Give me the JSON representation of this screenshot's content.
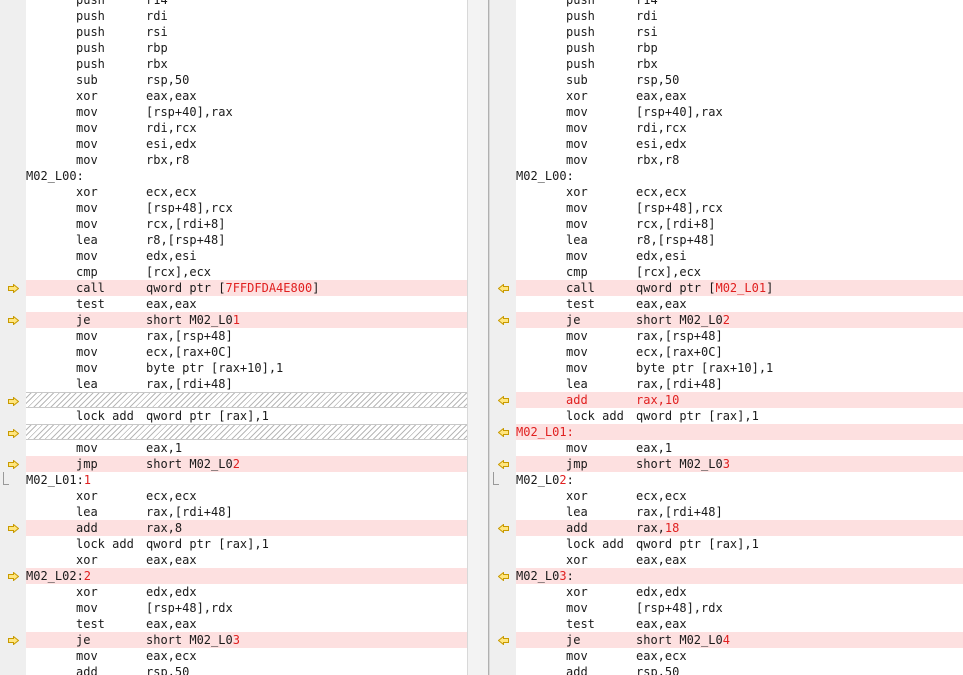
{
  "colors": {
    "changed_bg": "#fde0e0",
    "diff_text": "#e02020",
    "marker": "#e0b000"
  },
  "left_pane": {
    "lines": [
      {
        "op": "push",
        "args": "r14"
      },
      {
        "op": "push",
        "args": "rdi"
      },
      {
        "op": "push",
        "args": "rsi"
      },
      {
        "op": "push",
        "args": "rbp"
      },
      {
        "op": "push",
        "args": "rbx"
      },
      {
        "op": "sub",
        "args": "rsp,50"
      },
      {
        "op": "xor",
        "args": "eax,eax"
      },
      {
        "op": "mov",
        "args": "[rsp+40],rax"
      },
      {
        "op": "mov",
        "args": "rdi,rcx"
      },
      {
        "op": "mov",
        "args": "esi,edx"
      },
      {
        "op": "mov",
        "args": "rbx,r8"
      },
      {
        "label": "M02_L00:"
      },
      {
        "op": "xor",
        "args": "ecx,ecx"
      },
      {
        "op": "mov",
        "args": "[rsp+48],rcx"
      },
      {
        "op": "mov",
        "args": "rcx,[rdi+8]"
      },
      {
        "op": "lea",
        "args": "r8,[rsp+48]"
      },
      {
        "op": "mov",
        "args": "edx,esi"
      },
      {
        "op": "cmp",
        "args": "[rcx],ecx"
      },
      {
        "op": "call",
        "args": "qword ptr [",
        "args_red": "7FFDFDA4E800",
        "args_after": "]",
        "changed": true,
        "marker": "arrow"
      },
      {
        "op": "test",
        "args": "eax,eax"
      },
      {
        "op": "je",
        "args": "short M02_L0",
        "args_red": "1",
        "changed": true,
        "marker": "arrow"
      },
      {
        "op": "mov",
        "args": "rax,[rsp+48]"
      },
      {
        "op": "mov",
        "args": "ecx,[rax+0C]"
      },
      {
        "op": "mov",
        "args": "byte ptr [rax+10],1"
      },
      {
        "op": "lea",
        "args": "rax,[rdi+48]"
      },
      {
        "missing": true,
        "marker": "arrow"
      },
      {
        "op": "lock add",
        "args": "qword ptr [rax],1"
      },
      {
        "missing": true,
        "marker": "arrow"
      },
      {
        "op": "mov",
        "args": "eax,1"
      },
      {
        "op": "jmp",
        "args": "short M02_L0",
        "args_red": "2",
        "changed": true,
        "marker": "arrow"
      },
      {
        "label": "M02_L01:",
        "label_red": "1",
        "changed_label": true,
        "marker": "bracket"
      },
      {
        "op": "xor",
        "args": "ecx,ecx"
      },
      {
        "op": "lea",
        "args": "rax,[rdi+48]"
      },
      {
        "op": "add",
        "args": "rax,8",
        "changed": true,
        "marker": "arrow"
      },
      {
        "op": "lock add",
        "args": "qword ptr [rax],1"
      },
      {
        "op": "xor",
        "args": "eax,eax"
      },
      {
        "label": "M02_L02:",
        "label_red": "2",
        "changed": true,
        "marker": "arrow"
      },
      {
        "op": "xor",
        "args": "edx,edx"
      },
      {
        "op": "mov",
        "args": "[rsp+48],rdx"
      },
      {
        "op": "test",
        "args": "eax,eax"
      },
      {
        "op": "je",
        "args": "short M02_L0",
        "args_red": "3",
        "changed": true,
        "marker": "arrow"
      },
      {
        "op": "mov",
        "args": "eax,ecx"
      },
      {
        "op": "add",
        "args": "rsp,50"
      }
    ]
  },
  "right_pane": {
    "lines": [
      {
        "op": "push",
        "args": "r14"
      },
      {
        "op": "push",
        "args": "rdi"
      },
      {
        "op": "push",
        "args": "rsi"
      },
      {
        "op": "push",
        "args": "rbp"
      },
      {
        "op": "push",
        "args": "rbx"
      },
      {
        "op": "sub",
        "args": "rsp,50"
      },
      {
        "op": "xor",
        "args": "eax,eax"
      },
      {
        "op": "mov",
        "args": "[rsp+40],rax"
      },
      {
        "op": "mov",
        "args": "rdi,rcx"
      },
      {
        "op": "mov",
        "args": "esi,edx"
      },
      {
        "op": "mov",
        "args": "rbx,r8"
      },
      {
        "label": "M02_L00:"
      },
      {
        "op": "xor",
        "args": "ecx,ecx"
      },
      {
        "op": "mov",
        "args": "[rsp+48],rcx"
      },
      {
        "op": "mov",
        "args": "rcx,[rdi+8]"
      },
      {
        "op": "lea",
        "args": "r8,[rsp+48]"
      },
      {
        "op": "mov",
        "args": "edx,esi"
      },
      {
        "op": "cmp",
        "args": "[rcx],ecx"
      },
      {
        "op": "call",
        "args": "qword ptr [",
        "args_red": "M02_L01",
        "args_after": "]",
        "changed": true,
        "marker": "arrow"
      },
      {
        "op": "test",
        "args": "eax,eax"
      },
      {
        "op": "je",
        "args": "short M02_L0",
        "args_red": "2",
        "changed": true,
        "marker": "arrow"
      },
      {
        "op": "mov",
        "args": "rax,[rsp+48]"
      },
      {
        "op": "mov",
        "args": "ecx,[rax+0C]"
      },
      {
        "op": "mov",
        "args": "byte ptr [rax+10],1"
      },
      {
        "op": "lea",
        "args": "rax,[rdi+48]"
      },
      {
        "op": "add",
        "op_red": true,
        "args": "",
        "args_red": "rax,10",
        "changed": true,
        "marker": "arrow"
      },
      {
        "op": "lock add",
        "args": "qword ptr [rax],1"
      },
      {
        "label": "",
        "label_red": "M02_L01:",
        "changed": true,
        "marker": "arrow"
      },
      {
        "op": "mov",
        "args": "eax,1"
      },
      {
        "op": "jmp",
        "args": "short M02_L0",
        "args_red": "3",
        "changed": true,
        "marker": "arrow"
      },
      {
        "label": "M02_L0",
        "label_red": "2",
        "label_after": ":",
        "changed_label": true,
        "marker": "bracket"
      },
      {
        "op": "xor",
        "args": "ecx,ecx"
      },
      {
        "op": "lea",
        "args": "rax,[rdi+48]"
      },
      {
        "op": "add",
        "args": "rax,",
        "args_red": "18",
        "changed": true,
        "marker": "arrow"
      },
      {
        "op": "lock add",
        "args": "qword ptr [rax],1"
      },
      {
        "op": "xor",
        "args": "eax,eax"
      },
      {
        "label": "M02_L0",
        "label_red": "3",
        "label_after": ":",
        "changed": true,
        "marker": "arrow"
      },
      {
        "op": "xor",
        "args": "edx,edx"
      },
      {
        "op": "mov",
        "args": "[rsp+48],rdx"
      },
      {
        "op": "test",
        "args": "eax,eax"
      },
      {
        "op": "je",
        "args": "short M02_L0",
        "args_red": "4",
        "changed": true,
        "marker": "arrow"
      },
      {
        "op": "mov",
        "args": "eax,ecx"
      },
      {
        "op": "add",
        "args": "rsp,50"
      }
    ]
  }
}
